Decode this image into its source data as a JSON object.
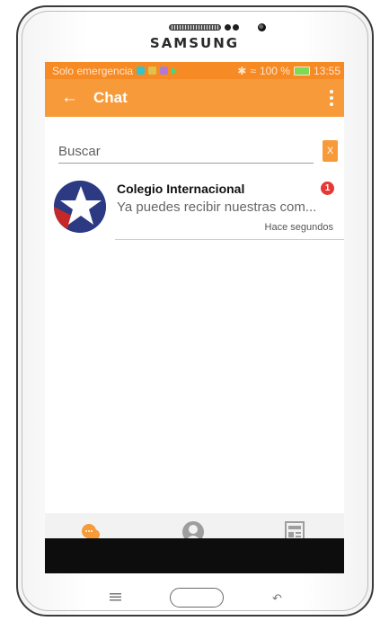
{
  "device": {
    "brand": "SAMSUNG"
  },
  "status_bar": {
    "carrier": "Solo emergencia",
    "battery": "100 %",
    "time": "13:55"
  },
  "app_bar": {
    "title": "Chat",
    "back_icon": "arrow-left-icon",
    "menu_icon": "more-vert-icon",
    "color": "#f79a3a"
  },
  "search": {
    "placeholder": "Buscar",
    "clear_label": "X"
  },
  "chats": [
    {
      "name": "Colegio Internacional",
      "preview": "Ya puedes recibir nuestras com...",
      "time": "Hace segundos",
      "unread": "1"
    }
  ],
  "bottom_nav": {
    "items": [
      "chat-icon",
      "contacts-icon",
      "news-icon"
    ]
  },
  "colors": {
    "accent": "#f79a3a",
    "status_bar": "#f68b25",
    "badge": "#e53935"
  }
}
